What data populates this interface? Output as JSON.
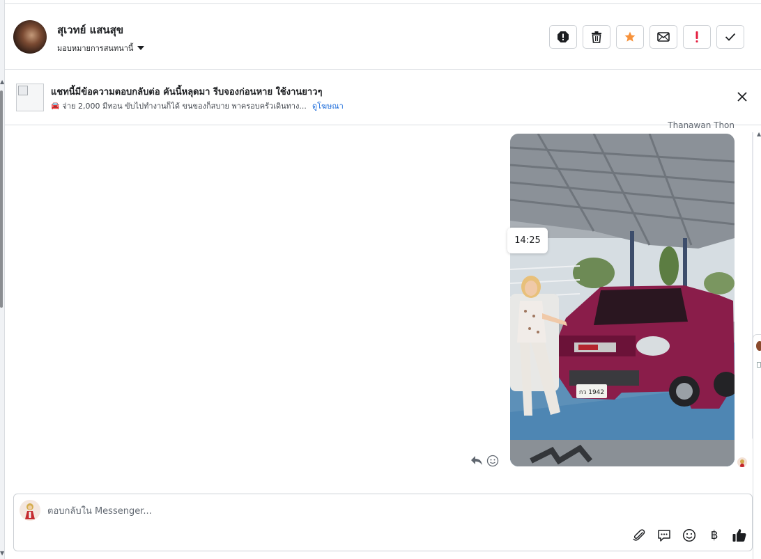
{
  "header": {
    "contact_name": "สุเวทย์ แสนสุข",
    "assign_label": "มอบหมายการสนทนานี้",
    "actions": [
      {
        "name": "spam-icon"
      },
      {
        "name": "trash-icon"
      },
      {
        "name": "star-icon",
        "color": "#f7923b"
      },
      {
        "name": "mail-icon"
      },
      {
        "name": "important-icon",
        "color": "#e41e3f"
      },
      {
        "name": "check-icon"
      }
    ]
  },
  "banner": {
    "title": "แชทนี้มีข้อความตอบกลับต่อ คันนี้หลุดมา รีบจองก่อนหาย ใช้งานยาวๆ",
    "subtitle": "จ่าย 2,000 มีทอน ขับไปทำงานก็ได้ ขนของก็สบาย พาครอบครัวเดินทาง...",
    "link": "ดูโฆษณา"
  },
  "conversation": {
    "sender_name": "Thanawan Thon",
    "timestamp": "14:25",
    "plate_text": "กว 1942"
  },
  "composer": {
    "placeholder": "ตอบกลับใน Messenger...",
    "tools": [
      "attachment-icon",
      "saved-reply-icon",
      "emoji-icon",
      "payment-icon",
      "like-icon"
    ],
    "baht_symbol": "฿"
  },
  "colors": {
    "accent_link": "#216fdb",
    "star": "#f7923b",
    "important": "#e41e3f",
    "border": "#ccd0d5"
  }
}
